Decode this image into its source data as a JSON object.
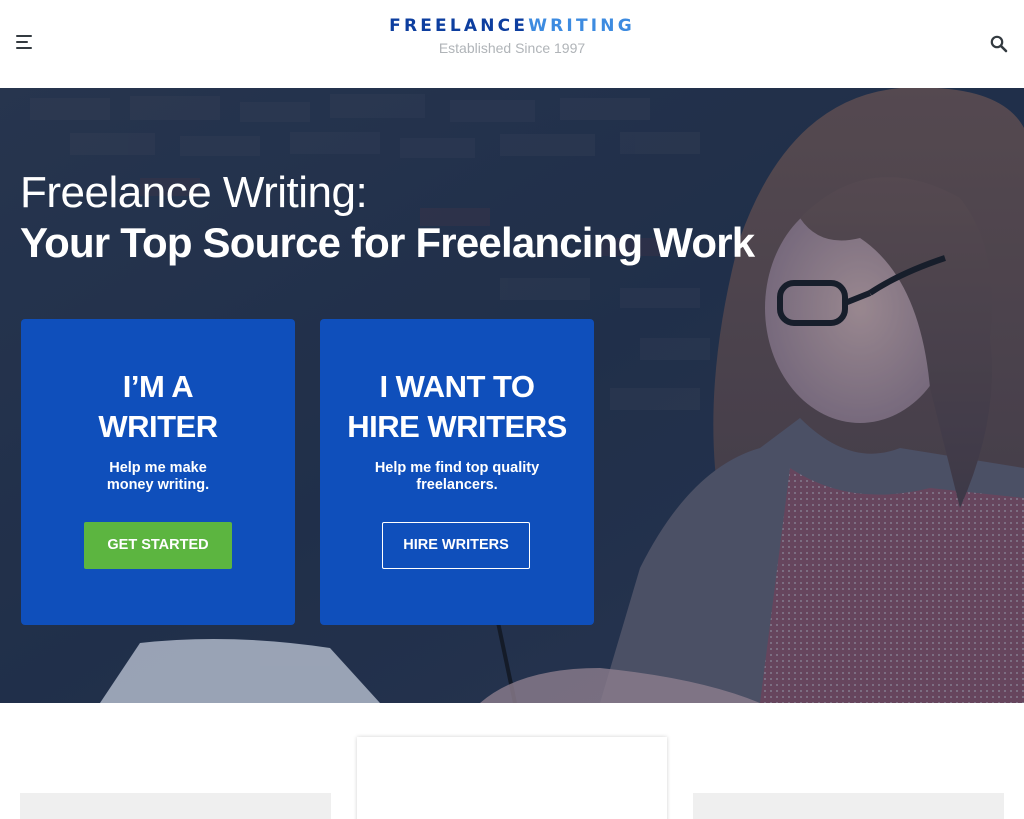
{
  "header": {
    "logo_part1": "FREELANCE",
    "logo_part2": "WRITING",
    "tagline": "Established Since 1997",
    "menu_icon": "hamburger-menu-icon",
    "search_icon": "search-icon"
  },
  "hero": {
    "title_light": "Freelance Writing:",
    "title_bold": "Your Top Source for Freelancing Work",
    "writer_card": {
      "title_line1": "I’M A",
      "title_line2": "WRITER",
      "sub_line1": "Help me make",
      "sub_line2": "money writing.",
      "button_label": "GET STARTED"
    },
    "hire_card": {
      "title_line1": "I WANT TO",
      "title_line2": "HIRE WRITERS",
      "sub_line1": "Help me find top quality",
      "sub_line2": "freelancers.",
      "button_label": "HIRE WRITERS"
    }
  },
  "colors": {
    "brand_dark_blue": "#0d3e9f",
    "brand_light_blue": "#3d8be0",
    "card_blue": "#0f4fbb",
    "cta_green": "#5cb540",
    "tagline_gray": "#b0b4b8"
  }
}
